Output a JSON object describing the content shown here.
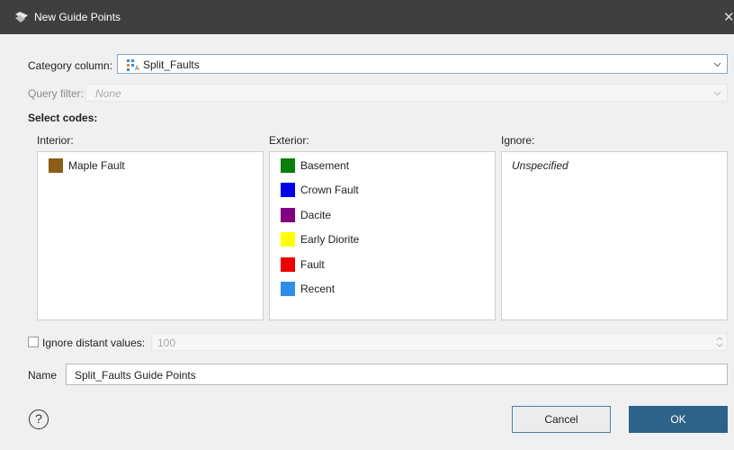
{
  "window": {
    "title": "New Guide Points"
  },
  "category": {
    "label": "Category column:",
    "value": "Split_Faults",
    "icon": "category-column-icon"
  },
  "query": {
    "label": "Query filter:",
    "placeholder": "None"
  },
  "select_codes": {
    "heading": "Select codes:",
    "interior": {
      "label": "Interior:",
      "items": [
        {
          "label": "Maple Fault",
          "color": "#8b5e14"
        }
      ]
    },
    "exterior": {
      "label": "Exterior:",
      "items": [
        {
          "label": "Basement",
          "color": "#0a7d0a"
        },
        {
          "label": "Crown Fault",
          "color": "#0000ee"
        },
        {
          "label": "Dacite",
          "color": "#800080"
        },
        {
          "label": "Early Diorite",
          "color": "#ffff00"
        },
        {
          "label": "Fault",
          "color": "#ee0000"
        },
        {
          "label": "Recent",
          "color": "#2e8de6"
        }
      ]
    },
    "ignore": {
      "label": "Ignore:",
      "items": [
        {
          "label": "Unspecified"
        }
      ]
    }
  },
  "distant": {
    "label": "Ignore distant values:",
    "value": "100",
    "checked": false
  },
  "name": {
    "label": "Name",
    "value": "Split_Faults Guide Points"
  },
  "buttons": {
    "cancel": "Cancel",
    "ok": "OK"
  },
  "colors": {
    "titlebar": "#3f3f3f",
    "ok_button": "#2d6388",
    "accent_border": "#8aa7bf"
  }
}
